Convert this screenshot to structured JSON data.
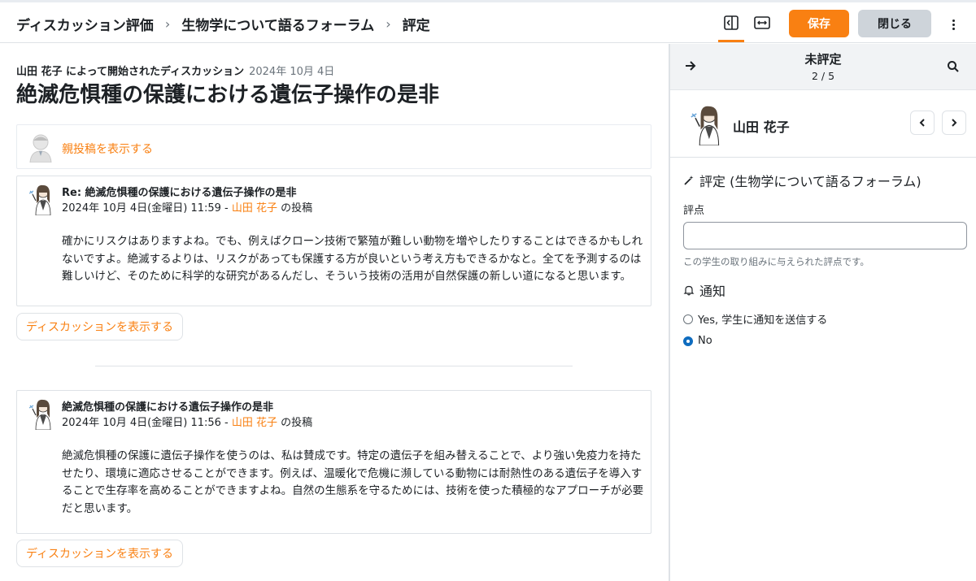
{
  "breadcrumb": {
    "items": [
      "ディスカッション評価",
      "生物学について語るフォーラム",
      "評定"
    ],
    "separator": "›"
  },
  "toolbar": {
    "save_label": "保存",
    "close_label": "閉じる",
    "icons": [
      "collapse-panel-icon",
      "expand-width-icon",
      "more-menu-icon"
    ],
    "accent_color": "#f98012"
  },
  "discussion": {
    "started_by": "山田 花子 によって開始されたディスカッション",
    "started_date": "2024年 10月 4日",
    "title": "絶滅危惧種の保護における遺伝子操作の是非",
    "show_parent_label": "親投稿を表示する",
    "posts": [
      {
        "subject": "Re: 絶滅危惧種の保護における遺伝子操作の是非",
        "date": "2024年 10月 4日(金曜日) 11:59 - ",
        "author": "山田 花子",
        "suffix": " の投稿",
        "body": "確かにリスクはありますよね。でも、例えばクローン技術で繁殖が難しい動物を増やしたりすることはできるかもしれないですよ。絶滅するよりは、リスクがあっても保護する方が良いという考え方もできるかなと。全てを予測するのは難しいけど、そのために科学的な研究があるんだし、そういう技術の活用が自然保護の新しい道になると思います。",
        "show_discussion_label": "ディスカッションを表示する"
      },
      {
        "subject": "絶滅危惧種の保護における遺伝子操作の是非",
        "date": "2024年 10月 4日(金曜日) 11:56 - ",
        "author": "山田 花子",
        "suffix": " の投稿",
        "body": "絶滅危惧種の保護に遺伝子操作を使うのは、私は賛成です。特定の遺伝子を組み替えることで、より強い免疫力を持たせたり、環境に適応させることができます。例えば、温暖化で危機に瀕している動物には耐熱性のある遺伝子を導入することで生存率を高めることができますよね。自然の生態系を守るためには、技術を使った積極的なアプローチが必要だと思います。",
        "show_discussion_label": "ディスカッションを表示する"
      }
    ]
  },
  "grader": {
    "status": "未評定",
    "position": "2 / 5",
    "user_name": "山田 花子",
    "grade_heading": "評定 (生物学について語るフォーラム)",
    "grade_label": "評点",
    "grade_value": "",
    "grade_help": "この学生の取り組みに与えられた評点です。",
    "notify_heading": "通知",
    "notify_options": [
      {
        "label": "Yes, 学生に通知を送信する",
        "checked": false
      },
      {
        "label": "No",
        "checked": true
      }
    ],
    "radio_color": "#0f6cbf"
  }
}
